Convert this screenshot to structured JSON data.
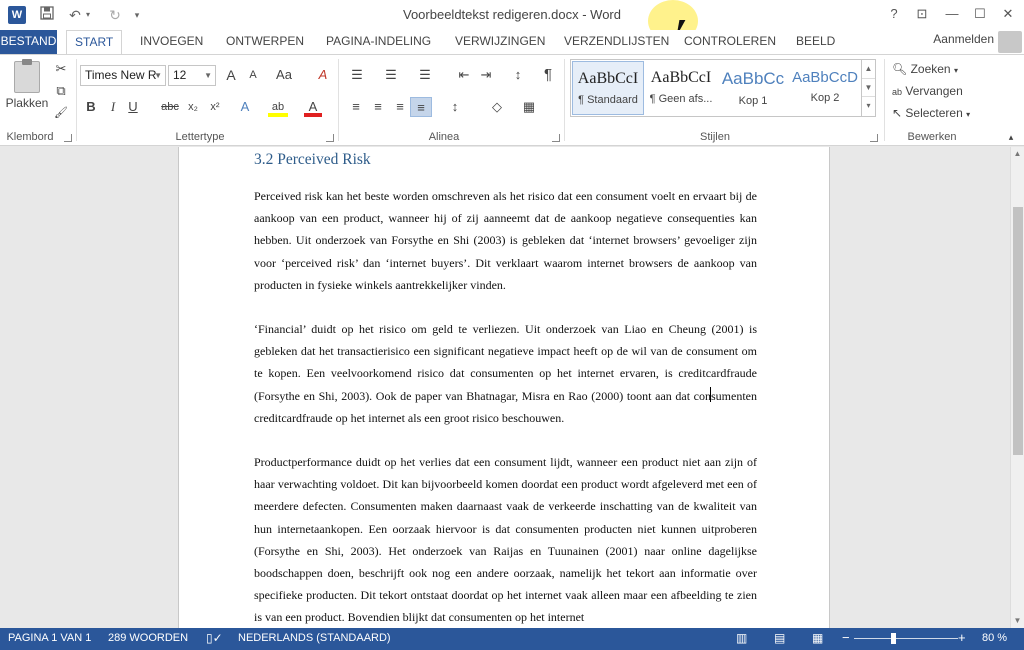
{
  "window": {
    "title": "Voorbeeldtekst redigeren.docx - Word",
    "app_icon": "W",
    "help": "?",
    "display_options": "⊡",
    "minimize": "—",
    "maximize": "☐",
    "close": "✕"
  },
  "qat": {
    "save": "💾",
    "undo": "↶",
    "undo_drop": "▾",
    "redo": "↻",
    "customize": "▾"
  },
  "tabs": [
    {
      "label": "BESTAND"
    },
    {
      "label": "START"
    },
    {
      "label": "INVOEGEN"
    },
    {
      "label": "ONTWERPEN"
    },
    {
      "label": "PAGINA-INDELING"
    },
    {
      "label": "VERWIJZINGEN"
    },
    {
      "label": "VERZENDLIJSTEN"
    },
    {
      "label": "CONTROLEREN"
    },
    {
      "label": "BEELD"
    }
  ],
  "account": {
    "signin": "Aanmelden"
  },
  "ribbon": {
    "clipboard": {
      "paste_label": "Plakken",
      "cut_icon": "✂",
      "copy_icon": "⧉",
      "format_painter_icon": "🖌",
      "group_label": "Klembord"
    },
    "font": {
      "font_name": "Times New R",
      "font_size": "12",
      "grow": "A",
      "shrink": "A",
      "case": "Aa",
      "clear": "A",
      "bold": "B",
      "italic": "I",
      "underline": "U",
      "strike": "abc",
      "subscript": "x₂",
      "superscript": "x²",
      "effects": "A",
      "highlight": "ab",
      "font_color": "A",
      "group_label": "Lettertype"
    },
    "paragraph": {
      "bullets": "☰",
      "numbering": "☰",
      "multilevel": "☰",
      "decrease_indent": "⇤",
      "increase_indent": "⇥",
      "sort": "↕",
      "pilcrow": "¶",
      "align_left": "≡",
      "align_center": "≡",
      "align_right": "≡",
      "justify": "≡",
      "line_spacing": "↕",
      "shading": "◇",
      "borders": "▦",
      "group_label": "Alinea"
    },
    "styles": {
      "items": [
        {
          "sample": "AaBbCcI",
          "name": "¶ Standaard"
        },
        {
          "sample": "AaBbCcI",
          "name": "¶ Geen afs..."
        },
        {
          "sample": "AaBbCc",
          "name": "Kop 1"
        },
        {
          "sample": "AaBbCcD",
          "name": "Kop 2"
        }
      ],
      "group_label": "Stijlen"
    },
    "editing": {
      "find": "Zoeken",
      "replace": "Vervangen",
      "select": "Selecteren",
      "group_label": "Bewerken"
    }
  },
  "document": {
    "heading": "3.2 Perceived Risk",
    "paragraphs": [
      "Perceived risk kan het beste worden omschreven als het risico dat een consument voelt en ervaart bij de aankoop van een product, wanneer hij of zij aanneemt dat de aankoop negatieve consequenties kan hebben. Uit onderzoek van Forsythe en Shi (2003) is gebleken dat ‘internet browsers’ gevoeliger zijn voor ‘perceived risk’ dan ‘internet buyers’. Dit verklaart waarom internet browsers de aankoop van producten in fysieke winkels aantrekkelijker vinden.",
      "‘Financial’ duidt op het risico om geld te verliezen. Uit onderzoek van Liao en Cheung (2001) is gebleken dat het transactierisico een significant negatieve impact heeft op de wil van de consument om te kopen. Een veelvoorkomend risico dat consumenten op het internet ervaren, is creditcardfraude (Forsythe en Shi, 2003). Ook de paper van Bhatnagar, Misra en Rao (2000) toont aan dat consumenten creditcardfraude op het internet als een groot risico beschouwen.",
      "Productperformance duidt op het verlies dat een consument lijdt, wanneer een product niet aan zijn of haar verwachting voldoet. Dit kan bijvoorbeeld komen doordat een product wordt afgeleverd met een of meerdere defecten. Consumenten maken daarnaast vaak de verkeerde inschatting van de kwaliteit van hun internetaankopen. Een oorzaak hiervoor is dat consumenten producten niet kunnen uitproberen (Forsythe en Shi, 2003). Het onderzoek van Raijas en Tuunainen (2001) naar online dagelijkse boodschappen doen, beschrijft ook nog een andere oorzaak, namelijk het tekort aan informatie over specifieke producten. Dit tekort ontstaat doordat op het internet vaak alleen maar een afbeelding te zien is van een product. Bovendien blijkt dat consumenten op het internet"
    ]
  },
  "status": {
    "page": "PAGINA 1 VAN 1",
    "words": "289 WOORDEN",
    "language": "NEDERLANDS (STANDAARD)",
    "zoom_minus": "−",
    "zoom_plus": "+",
    "zoom": "80 %",
    "zoom_level": 0.8
  },
  "colors": {
    "brand": "#2b579a",
    "heading": "#2e5c8a"
  }
}
